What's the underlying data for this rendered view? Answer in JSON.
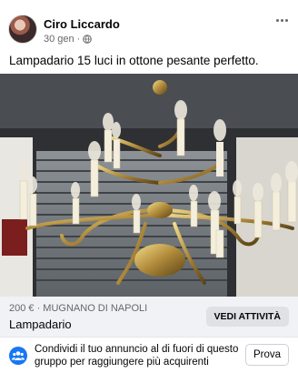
{
  "post": {
    "author": "Ciro Liccardo",
    "time": "30 gen",
    "caption": "Lampadario 15 luci in ottone pesante perfetto."
  },
  "listing": {
    "price_location": "200 € · MUGNANO DI NAPOLI",
    "title": "Lampadario",
    "view_label": "VEDI ATTIVITÀ"
  },
  "share": {
    "text": "Condividi il tuo annuncio al di fuori di questo gruppo per raggiungere più acquirenti",
    "button_label": "Prova"
  },
  "icons": {
    "more": "more-horizontal-icon",
    "privacy": "globe-icon",
    "share": "group-icon"
  }
}
